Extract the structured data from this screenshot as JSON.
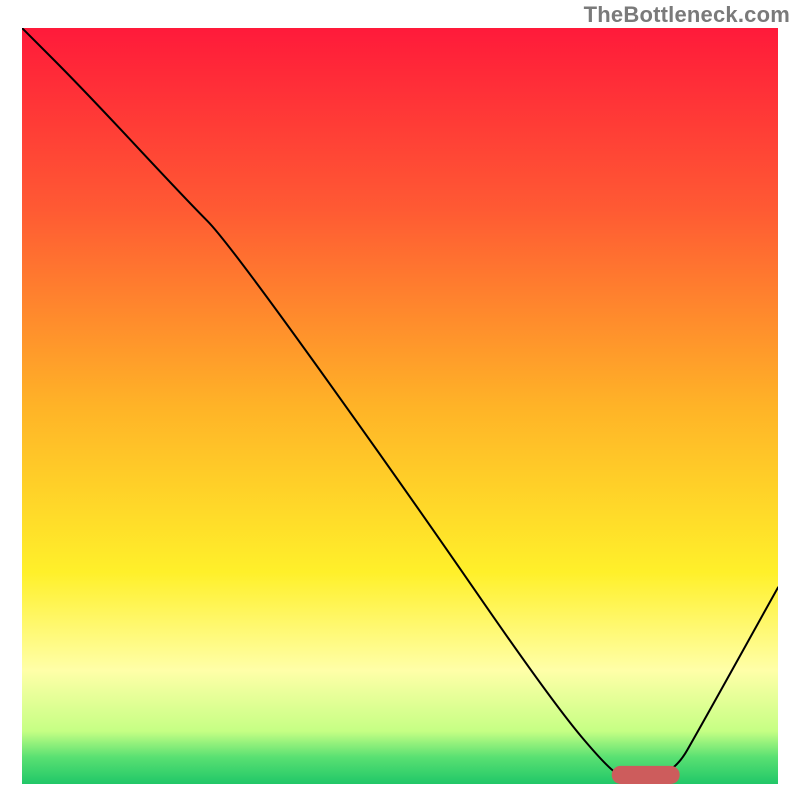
{
  "watermark": "TheBottleneck.com",
  "chart_data": {
    "type": "line",
    "title": "",
    "xlabel": "",
    "ylabel": "",
    "xlim": [
      0,
      100
    ],
    "ylim": [
      0,
      100
    ],
    "grid": false,
    "legend": false,
    "background_gradient": {
      "stops": [
        {
          "offset": 0.0,
          "color": "#ff1a3a"
        },
        {
          "offset": 0.24,
          "color": "#ff5a33"
        },
        {
          "offset": 0.5,
          "color": "#ffb327"
        },
        {
          "offset": 0.72,
          "color": "#fff02a"
        },
        {
          "offset": 0.85,
          "color": "#ffffa8"
        },
        {
          "offset": 0.93,
          "color": "#c6ff84"
        },
        {
          "offset": 0.965,
          "color": "#58e072"
        },
        {
          "offset": 1.0,
          "color": "#21c768"
        }
      ]
    },
    "series": [
      {
        "name": "bottleneck-curve",
        "x": [
          0,
          8,
          22,
          27,
          50,
          70,
          78,
          80,
          86,
          90,
          100
        ],
        "values": [
          100,
          92,
          77,
          72,
          40,
          11,
          1.5,
          1,
          1,
          8,
          26
        ]
      }
    ],
    "marker": {
      "name": "optimal-range-bar",
      "x_start": 78,
      "x_end": 87,
      "y": 1.2,
      "color": "#cd5c5c",
      "thickness": 2.4
    }
  }
}
